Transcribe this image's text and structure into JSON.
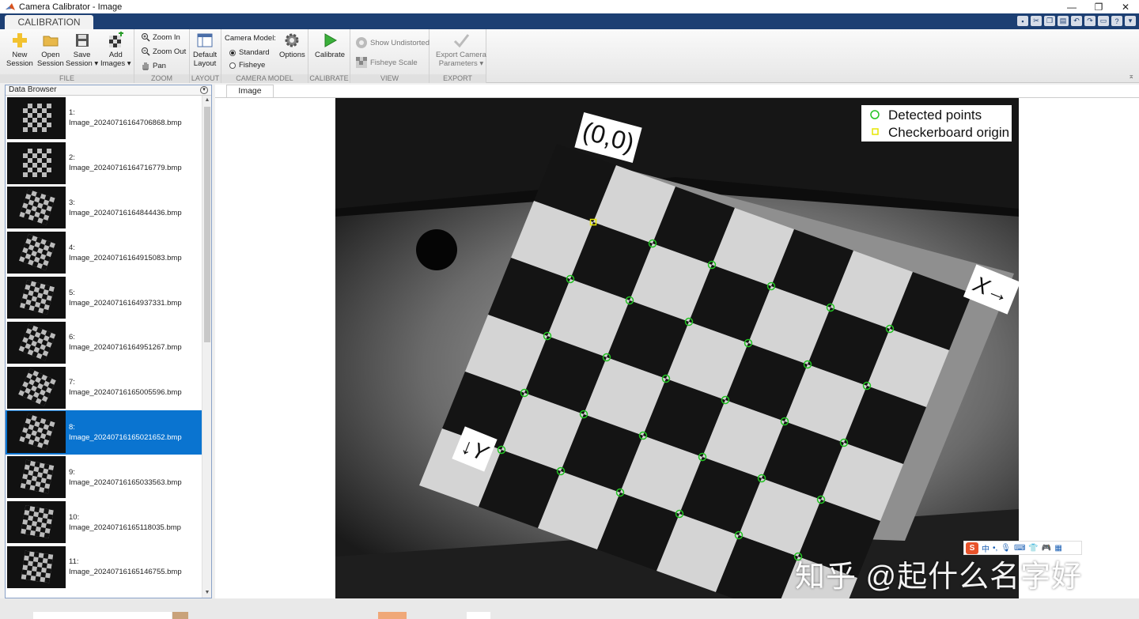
{
  "window": {
    "title": "Camera Calibrator - Image"
  },
  "window_buttons": [
    "—",
    "❐",
    "✕"
  ],
  "ribbon_tab": "CALIBRATION",
  "ribbon": {
    "file": {
      "label": "FILE",
      "new": [
        "New",
        "Session"
      ],
      "open": [
        "Open",
        "Session"
      ],
      "save": [
        "Save",
        "Session ▾"
      ],
      "add": [
        "Add",
        "Images ▾"
      ]
    },
    "zoom": {
      "label": "ZOOM",
      "zoom_in": "Zoom In",
      "zoom_out": "Zoom Out",
      "pan": "Pan"
    },
    "layout": {
      "label": "LAYOUT",
      "default": [
        "Default",
        "Layout"
      ]
    },
    "camera_model": {
      "label": "CAMERA MODEL",
      "heading": "Camera Model:",
      "standard": "Standard",
      "fisheye": "Fisheye",
      "options": "Options"
    },
    "calibrate": {
      "label": "CALIBRATE",
      "button": "Calibrate"
    },
    "view": {
      "label": "VIEW",
      "show_undistorted": "Show Undistorted",
      "fisheye_scale": "Fisheye Scale"
    },
    "export": {
      "label": "EXPORT",
      "button": [
        "Export Camera",
        "Parameters ▾"
      ]
    }
  },
  "data_browser": {
    "title": "Data Browser",
    "selected_index": 7,
    "items": [
      {
        "num": "1:",
        "name": "Image_20240716164706868.bmp"
      },
      {
        "num": "2:",
        "name": "Image_20240716164716779.bmp"
      },
      {
        "num": "3:",
        "name": "Image_20240716164844436.bmp"
      },
      {
        "num": "4:",
        "name": "Image_20240716164915083.bmp"
      },
      {
        "num": "5:",
        "name": "Image_20240716164937331.bmp"
      },
      {
        "num": "6:",
        "name": "Image_20240716164951267.bmp"
      },
      {
        "num": "7:",
        "name": "Image_20240716165005596.bmp"
      },
      {
        "num": "8:",
        "name": "Image_20240716165021652.bmp"
      },
      {
        "num": "9:",
        "name": "Image_20240716165033563.bmp"
      },
      {
        "num": "10:",
        "name": "Image_20240716165118035.bmp"
      },
      {
        "num": "11:",
        "name": "Image_20240716165146755.bmp"
      }
    ]
  },
  "image_tab": "Image",
  "overlay": {
    "origin_label": "(0,0)",
    "x_label": "X→",
    "y_label": "↓Y",
    "legend": {
      "detected": "Detected points",
      "origin": "Checkerboard origin"
    },
    "colors": {
      "detected": "#22c322",
      "origin": "#e6e600"
    }
  },
  "watermark": "知乎 @起什么名字好",
  "ime_bar": {
    "logo": "S",
    "mode": "中"
  }
}
